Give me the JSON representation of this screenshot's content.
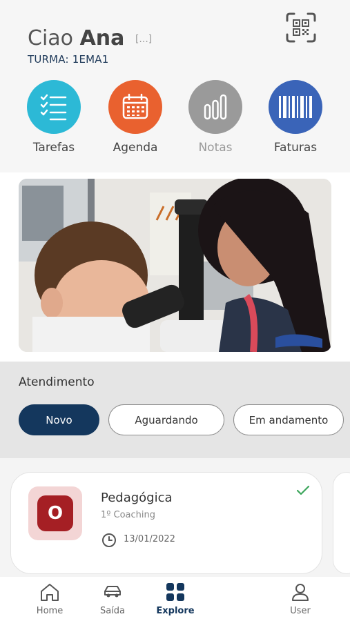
{
  "header": {
    "greeting_prefix": "Ciao",
    "user_name": "Ana",
    "more_label": "[...]",
    "turma": "TURMA: 1EMA1"
  },
  "shortcuts": [
    {
      "label": "Tarefas",
      "icon": "checklist-icon",
      "color": "#2cb9d6"
    },
    {
      "label": "Agenda",
      "icon": "calendar-icon",
      "color": "#e9612f"
    },
    {
      "label": "Notas",
      "icon": "bar-chart-icon",
      "color": "#9a9a9a"
    },
    {
      "label": "Faturas",
      "icon": "barcode-icon",
      "color": "#3a64b8"
    }
  ],
  "banner": {
    "icon": "banner-photo-microscope"
  },
  "atendimento": {
    "title": "Atendimento",
    "chips": [
      {
        "label": "Novo",
        "active": true
      },
      {
        "label": "Aguardando",
        "active": false
      },
      {
        "label": "Em andamento",
        "active": false
      }
    ]
  },
  "card": {
    "avatar_letter": "O",
    "title": "Pedagógica",
    "subtitle": "1º Coaching",
    "date": "13/01/2022",
    "status_color": "#3aa55a"
  },
  "tabbar": [
    {
      "label": "Home",
      "icon": "home-icon",
      "active": false
    },
    {
      "label": "Saída",
      "icon": "car-icon",
      "active": false
    },
    {
      "label": "Explore",
      "icon": "grid-icon",
      "active": true
    },
    {
      "label": "User",
      "icon": "user-icon",
      "active": false
    }
  ],
  "colors": {
    "primary": "#14375d",
    "chip_inactive_border": "#8a8a8a",
    "avatar_bg": "#a51f24"
  }
}
